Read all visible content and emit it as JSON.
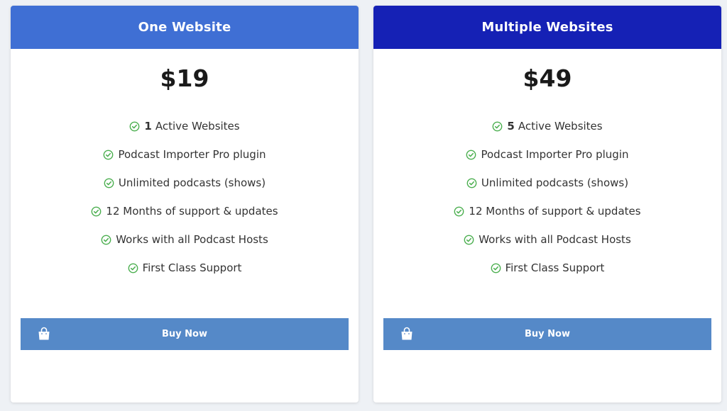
{
  "plans": [
    {
      "title": "One Website",
      "price": "$19",
      "features": [
        {
          "strong": "1",
          "text": "Active Websites"
        },
        {
          "strong": "",
          "text": "Podcast Importer Pro plugin"
        },
        {
          "strong": "",
          "text": "Unlimited podcasts (shows)"
        },
        {
          "strong": "",
          "text": "12 Months of support & updates"
        },
        {
          "strong": "",
          "text": "Works with all Podcast Hosts"
        },
        {
          "strong": "",
          "text": "First Class Support"
        }
      ],
      "button_label": "Buy Now",
      "header_color": "#3f6fd4"
    },
    {
      "title": "Multiple Websites",
      "price": "$49",
      "features": [
        {
          "strong": "5",
          "text": "Active Websites"
        },
        {
          "strong": "",
          "text": "Podcast Importer Pro plugin"
        },
        {
          "strong": "",
          "text": "Unlimited podcasts (shows)"
        },
        {
          "strong": "",
          "text": "12 Months of support & updates"
        },
        {
          "strong": "",
          "text": "Works with all Podcast Hosts"
        },
        {
          "strong": "",
          "text": "First Class Support"
        }
      ],
      "button_label": "Buy Now",
      "header_color": "#1521b5"
    }
  ],
  "colors": {
    "check": "#4caf50",
    "button": "#5589c8",
    "background": "#eef1f5"
  },
  "icons": {
    "feature": "check-circle-icon",
    "button": "shopping-bag-icon"
  }
}
